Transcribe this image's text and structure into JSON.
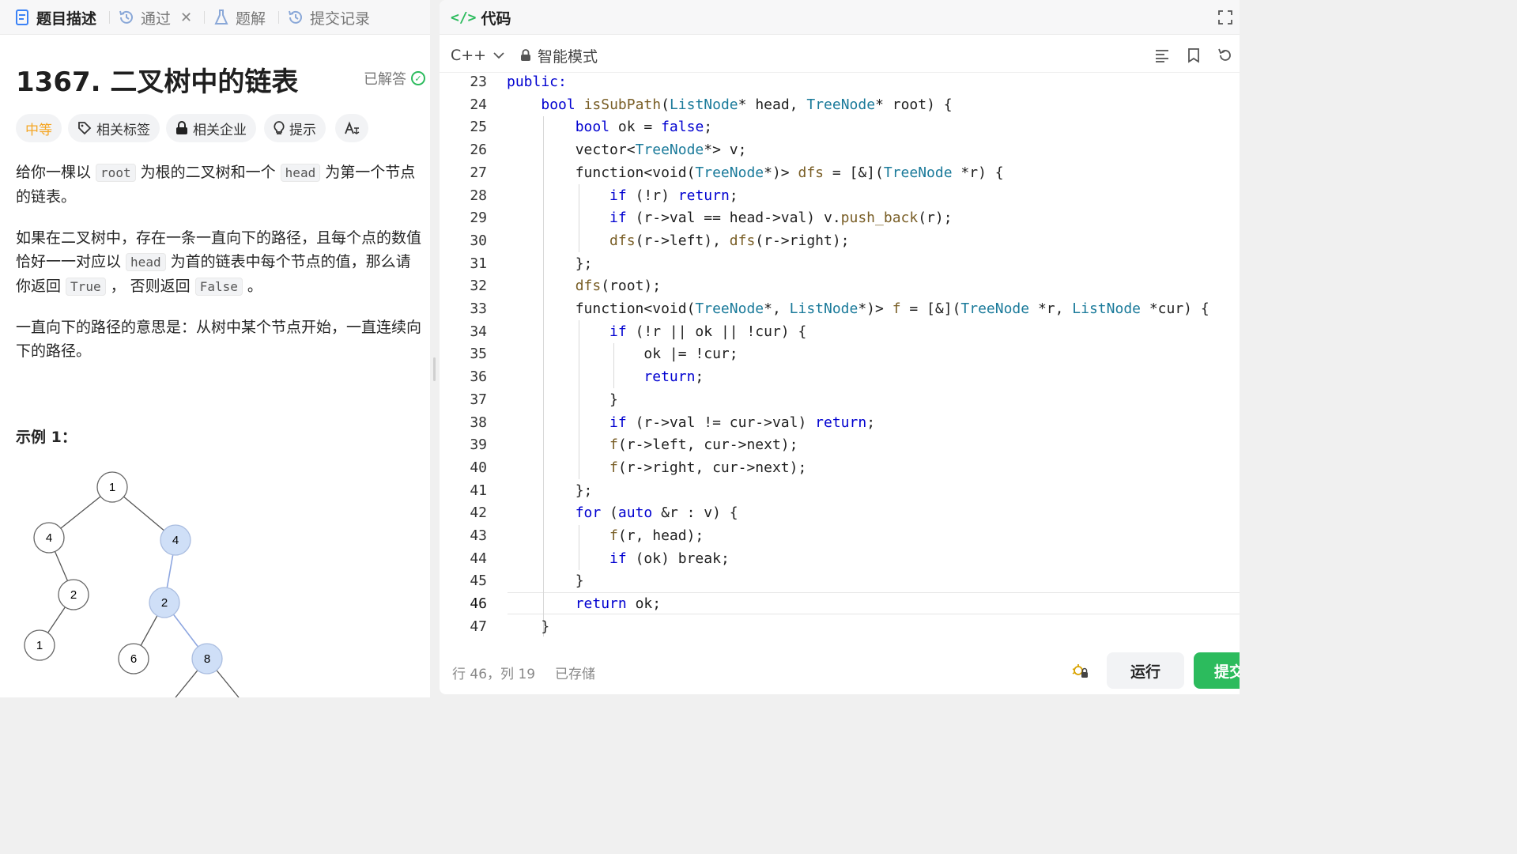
{
  "left_tabs": {
    "description": "题目描述",
    "accepted": "通过",
    "solutions": "题解",
    "submissions": "提交记录"
  },
  "problem": {
    "title": "1367. 二叉树中的链表",
    "status": "已解答",
    "difficulty": "中等",
    "chips": [
      "相关标签",
      "相关企业",
      "提示"
    ],
    "p1_a": "给你一棵以 ",
    "p1_code1": "root",
    "p1_b": " 为根的二叉树和一个 ",
    "p1_code2": "head",
    "p1_c": " 为第一个节点的链表。",
    "p2_a": "如果在二叉树中，存在一条一直向下的路径，且每个点的数值恰好一一对应以 ",
    "p2_code1": "head",
    "p2_b": " 为首的链表中每个节点的值，那么请你返回 ",
    "p2_code2": "True",
    "p2_c": " ， 否则返回 ",
    "p2_code3": "False",
    "p2_d": " 。",
    "p3": "一直向下的路径的意思是：从树中某个节点开始，一直连续向下的路径。",
    "example_title": "示例 1："
  },
  "tree_nodes": [
    "1",
    "4",
    "4",
    "2",
    "2",
    "1",
    "6",
    "8"
  ],
  "colors": {
    "accent_green": "#2cbb5d",
    "difficulty_medium": "#f5a623",
    "highlight_node": "#cfdff7",
    "keyword": "#0000d0",
    "type": "#1a7a9a"
  },
  "code_panel": {
    "title": "代码",
    "language": "C++",
    "mode": "智能模式",
    "run": "运行",
    "submit": "提交",
    "cursor": "行 46，列 19",
    "saved": "已存储"
  },
  "code_lines": [
    {
      "n": "23",
      "t": "public:"
    },
    {
      "n": "24",
      "t": "    bool isSubPath(ListNode* head, TreeNode* root) {"
    },
    {
      "n": "25",
      "t": "        bool ok = false;"
    },
    {
      "n": "26",
      "t": "        vector<TreeNode*> v;"
    },
    {
      "n": "27",
      "t": "        function<void(TreeNode*)> dfs = [&](TreeNode *r) {"
    },
    {
      "n": "28",
      "t": "            if (!r) return;"
    },
    {
      "n": "29",
      "t": "            if (r->val == head->val) v.push_back(r);"
    },
    {
      "n": "30",
      "t": "            dfs(r->left), dfs(r->right);"
    },
    {
      "n": "31",
      "t": "        };"
    },
    {
      "n": "32",
      "t": "        dfs(root);"
    },
    {
      "n": "33",
      "t": "        function<void(TreeNode*, ListNode*)> f = [&](TreeNode *r, ListNode *cur) {"
    },
    {
      "n": "34",
      "t": "            if (!r || ok || !cur) {"
    },
    {
      "n": "35",
      "t": "                ok |= !cur;"
    },
    {
      "n": "36",
      "t": "                return;"
    },
    {
      "n": "37",
      "t": "            }"
    },
    {
      "n": "38",
      "t": "            if (r->val != cur->val) return;"
    },
    {
      "n": "39",
      "t": "            f(r->left, cur->next);"
    },
    {
      "n": "40",
      "t": "            f(r->right, cur->next);"
    },
    {
      "n": "41",
      "t": "        };"
    },
    {
      "n": "42",
      "t": "        for (auto &r : v) {"
    },
    {
      "n": "43",
      "t": "            f(r, head);"
    },
    {
      "n": "44",
      "t": "            if (ok) break;"
    },
    {
      "n": "45",
      "t": "        }"
    },
    {
      "n": "46",
      "t": "        return ok;"
    },
    {
      "n": "47",
      "t": "    }"
    }
  ]
}
